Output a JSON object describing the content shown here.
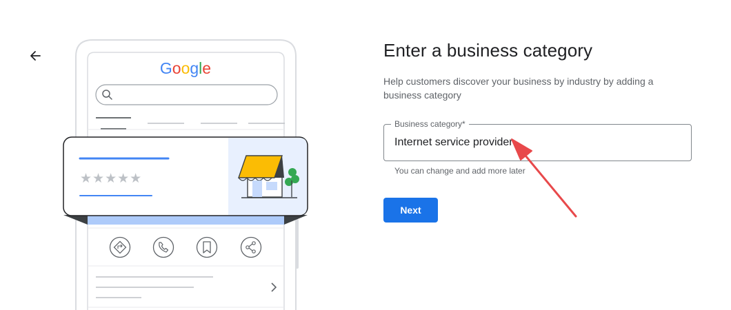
{
  "illustration": {
    "brand_letters": [
      {
        "ch": "G",
        "color": "#4285F4"
      },
      {
        "ch": "o",
        "color": "#EA4335"
      },
      {
        "ch": "o",
        "color": "#FBBC05"
      },
      {
        "ch": "g",
        "color": "#4285F4"
      },
      {
        "ch": "l",
        "color": "#34A853"
      },
      {
        "ch": "e",
        "color": "#EA4335"
      }
    ],
    "rating_stars": "★★★★★",
    "action_icons": [
      "directions-icon",
      "phone-icon",
      "bookmark-icon",
      "share-icon"
    ]
  },
  "page": {
    "title": "Enter a business category",
    "subtitle": "Help customers discover your business by industry by adding a business category"
  },
  "category_field": {
    "label": "Business category*",
    "value": "Internet service provider",
    "helper": "You can change and add more later"
  },
  "actions": {
    "next_label": "Next"
  },
  "colors": {
    "accent": "#1a73e8",
    "annotation": "#e8494b"
  }
}
